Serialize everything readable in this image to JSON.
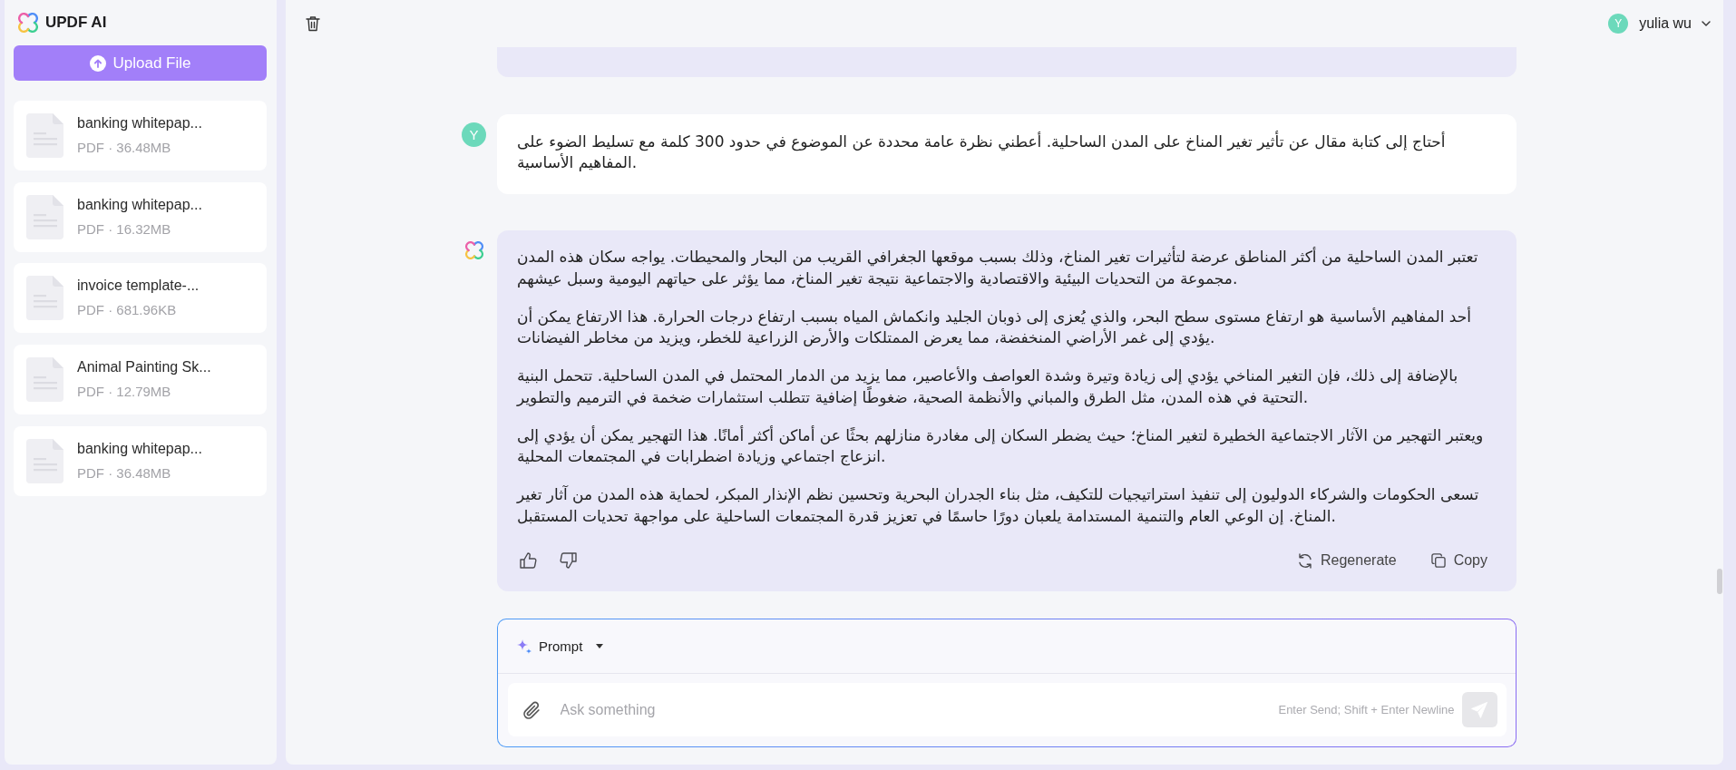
{
  "sidebar": {
    "title": "UPDF AI",
    "upload_button": "Upload File",
    "files": [
      {
        "name": "banking whitepap...",
        "meta": "PDF · 36.48MB"
      },
      {
        "name": "banking whitepap...",
        "meta": "PDF · 16.32MB"
      },
      {
        "name": "invoice template-...",
        "meta": "PDF · 681.96KB"
      },
      {
        "name": "Animal Painting Sk...",
        "meta": "PDF · 12.79MB"
      },
      {
        "name": "banking whitepap...",
        "meta": "PDF · 36.48MB"
      }
    ]
  },
  "header": {
    "user": {
      "initial": "Y",
      "name": "yulia wu"
    }
  },
  "messages": [
    {
      "kind": "cut_off"
    },
    {
      "kind": "user",
      "initial": "Y",
      "text": "أحتاج إلى كتابة مقال عن تأثير تغير المناخ على المدن الساحلية. أعطني نظرة عامة محددة عن الموضوع في حدود 300 كلمة مع تسليط الضوء على المفاهيم الأساسية."
    },
    {
      "kind": "assistant",
      "paragraphs": [
        "تعتبر المدن الساحلية من أكثر المناطق عرضة لتأثيرات تغير المناخ، وذلك بسبب موقعها الجغرافي القريب من البحار والمحيطات. يواجه سكان هذه المدن مجموعة من التحديات البيئية والاقتصادية والاجتماعية نتيجة تغير المناخ، مما يؤثر على حياتهم اليومية وسبل عيشهم.",
        "أحد المفاهيم الأساسية هو ارتفاع مستوى سطح البحر، والذي يُعزى إلى ذوبان الجليد وانكماش المياه بسبب ارتفاع درجات الحرارة. هذا الارتفاع يمكن أن يؤدي إلى غمر الأراضي المنخفضة، مما يعرض الممتلكات والأرض الزراعية للخطر، ويزيد من مخاطر الفيضانات.",
        "بالإضافة إلى ذلك، فإن التغير المناخي يؤدي إلى زيادة وتيرة وشدة العواصف والأعاصير، مما يزيد من الدمار المحتمل في المدن الساحلية. تتحمل البنية التحتية في هذه المدن، مثل الطرق والمباني والأنظمة الصحية، ضغوطًا إضافية تتطلب استثمارات ضخمة في الترميم والتطوير.",
        "ويعتبر التهجير من الآثار الاجتماعية الخطيرة لتغير المناخ؛ حيث يضطر السكان إلى مغادرة منازلهم بحثًا عن أماكن أكثر أمانًا. هذا التهجير يمكن أن يؤدي إلى انزعاج اجتماعي وزيادة اضطرابات في المجتمعات المحلية.",
        "تسعى الحكومات والشركاء الدوليون إلى تنفيذ استراتيجيات للتكيف، مثل بناء الجدران البحرية وتحسين نظم الإنذار المبكر، لحماية هذه المدن من آثار تغير المناخ. إن الوعي العام والتنمية المستدامة يلعبان دورًا حاسمًا في تعزيز قدرة المجتمعات الساحلية على مواجهة تحديات المستقبل."
      ],
      "regenerate_button": "Regenerate",
      "copy_button": "Copy"
    }
  ],
  "composer": {
    "mode": "Prompt",
    "placeholder": "Ask something",
    "hint": "Enter Send; Shift + Enter Newline"
  }
}
